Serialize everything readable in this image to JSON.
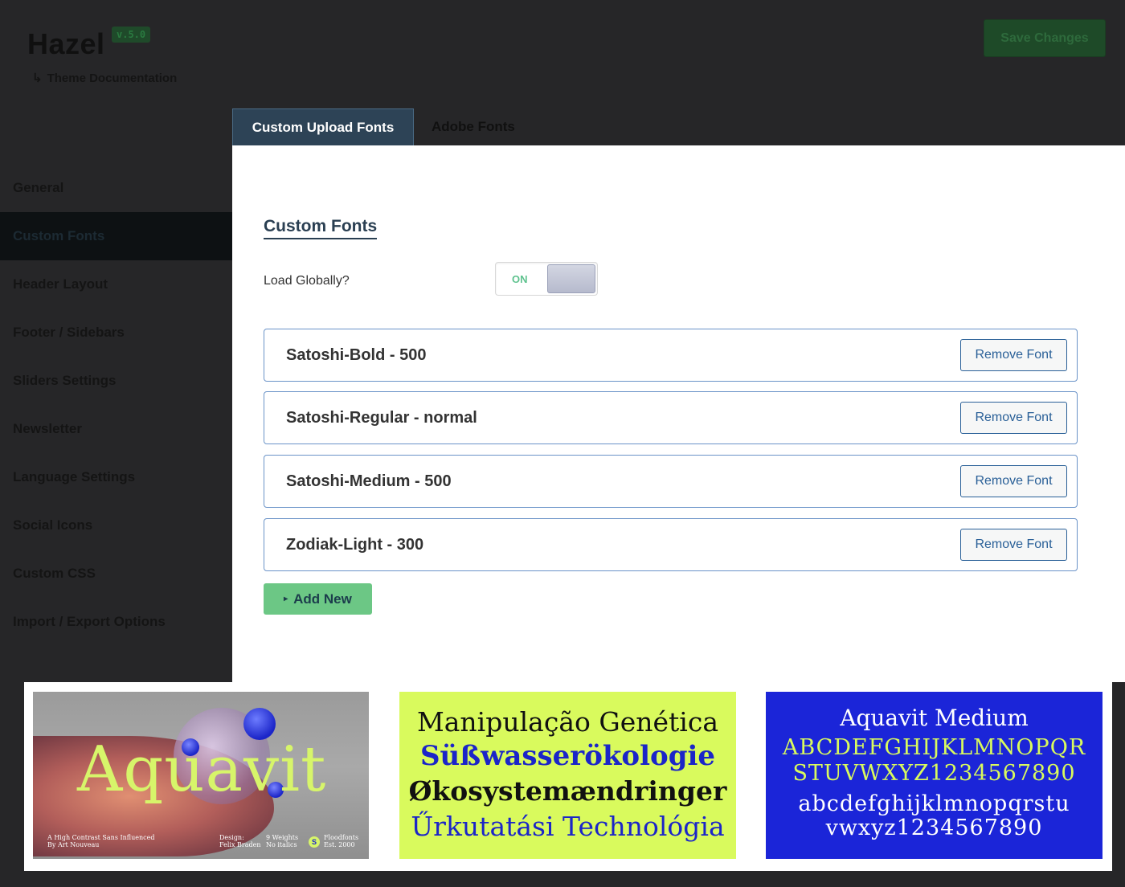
{
  "header": {
    "brand": "Hazel",
    "version": "v.5.0",
    "doc_arrow": "↳",
    "doc_link": "Theme Documentation",
    "save_label": "Save Changes"
  },
  "sidebar": {
    "items": [
      {
        "label": "General"
      },
      {
        "label": "Custom Fonts",
        "active": true
      },
      {
        "label": "Header Layout"
      },
      {
        "label": "Footer / Sidebars"
      },
      {
        "label": "Sliders Settings"
      },
      {
        "label": "Newsletter"
      },
      {
        "label": "Language Settings"
      },
      {
        "label": "Social Icons"
      },
      {
        "label": "Custom CSS"
      },
      {
        "label": "Import / Export Options"
      }
    ]
  },
  "tabs": [
    {
      "label": "Custom Upload Fonts",
      "active": true
    },
    {
      "label": "Adobe Fonts",
      "active": false
    }
  ],
  "main": {
    "section_title": "Custom Fonts",
    "load_globally_label": "Load Globally?",
    "toggle_state": "ON",
    "fonts": [
      {
        "name": "Satoshi-Bold - 500"
      },
      {
        "name": "Satoshi-Regular - normal"
      },
      {
        "name": "Satoshi-Medium - 500"
      },
      {
        "name": "Zodiak-Light - 300"
      }
    ],
    "remove_label": "Remove Font",
    "add_caret": "▸",
    "add_label": "Add New"
  },
  "showcase": {
    "card1": {
      "title": "Aquavit",
      "desc_1": "A High Contrast Sans Influenced",
      "desc_2": "By Art Nouveau",
      "design_1": "Design:",
      "design_2": "Felix Braden",
      "weights_1": "9 Weights",
      "weights_2": "No italics",
      "logo_glyph": "S",
      "foundry_1": "Floodfonts",
      "foundry_2": "Est. 2000"
    },
    "card2": {
      "line1": "Manipulação Genética",
      "line2": "Süßwasserökologie",
      "line3": "Økosystemændringer",
      "line4": "Űrkutatási Technológia"
    },
    "card3": {
      "title": "Aquavit Medium",
      "upper1": "ABCDEFGHIJKLMNOPQR",
      "upper2": "STUVWXYZ1234567890",
      "lower1": "abcdefghijklmnopqrstu",
      "lower2": "vwxyz1234567890"
    }
  },
  "colors": {
    "background": "#262628",
    "active_tab": "#2d4356",
    "accent_green": "#6cc785",
    "link_blue": "#2a6098",
    "lime": "#d9fa5d",
    "royal_blue": "#1b25d8"
  }
}
